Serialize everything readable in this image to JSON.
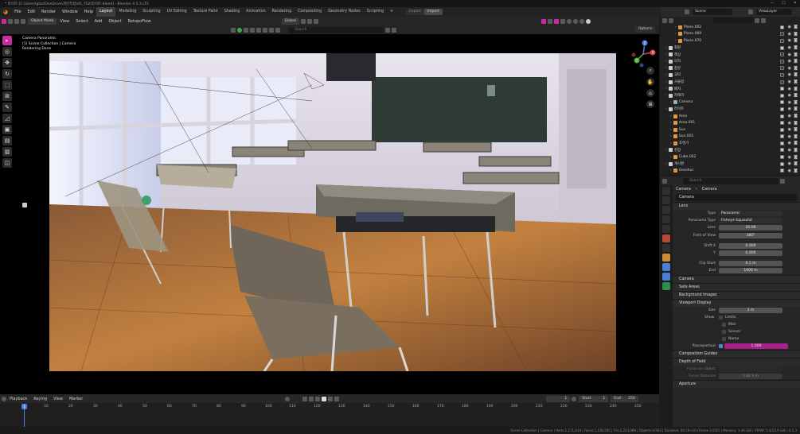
{
  "titlebar": {
    "text": "* 라이트 [C:\\Users\\glzx\\OneDrive\\개인작업\\05_학교\\라이트.blend] - Blender 4.5.3 LTS",
    "minimize": "—",
    "maximize": "☐",
    "close": "✕"
  },
  "menu": [
    "File",
    "Edit",
    "Render",
    "Window",
    "Help"
  ],
  "workspaces": [
    "Layout",
    "Modeling",
    "Sculpting",
    "UV Editing",
    "Texture Paint",
    "Shading",
    "Animation",
    "Rendering",
    "Compositing",
    "Geometry Nodes",
    "Scripting"
  ],
  "workspace_add": "+",
  "export_label": "Export",
  "import_label": "Import",
  "scene_label": "Scene",
  "viewlayer_label": "ViewLayer",
  "viewport_header": {
    "mode": "Object Mode",
    "menus": [
      "View",
      "Select",
      "Add",
      "Object"
    ],
    "retopo": "RetopoFlow",
    "transform": "Global"
  },
  "viewport_tools": {
    "search_placeholder": "Search"
  },
  "options_label": "Options",
  "render_info": [
    "Camera Panoramic",
    "(1) Scene Collection | Camera",
    "Rendering Done"
  ],
  "gizmo": {
    "x": "X",
    "y": "Y",
    "z": "Z"
  },
  "timeline": {
    "menus": [
      "Playback",
      "Keying",
      "View",
      "Marker"
    ],
    "current_frame": "1",
    "start_label": "Start",
    "start": "1",
    "end_label": "End",
    "end": "250",
    "ticks": [
      "10",
      "20",
      "30",
      "40",
      "50",
      "60",
      "70",
      "80",
      "90",
      "100",
      "110",
      "120",
      "130",
      "140",
      "150",
      "160",
      "170",
      "180",
      "190",
      "200",
      "210",
      "220",
      "230",
      "240",
      "250"
    ],
    "playhead": "1"
  },
  "statusbar": "Scene Collection | Camera | Verts:1,171,414 | Faces:1,138,595 | Tris:2,223,089 | Objects:0/363 | Duration: 00:10+10 (Frame 1/250) | Memory: 3.46 GiB | VRAM: 5.4/23.9 GiB | 4.5.3",
  "outliner": {
    "search_placeholder": "",
    "rows": [
      {
        "indent": 2,
        "label": "Plane.002",
        "color": "#e39a3b",
        "check": true
      },
      {
        "indent": 2,
        "label": "Plane.069",
        "color": "#e39a3b",
        "check": false
      },
      {
        "indent": 2,
        "label": "Plane.070",
        "color": "#e39a3b",
        "check": false
      },
      {
        "indent": 0,
        "label": "칠판",
        "color": "#cfcfcf",
        "check": true
      },
      {
        "indent": 0,
        "label": "책상",
        "color": "#cfcfcf",
        "check": false
      },
      {
        "indent": 0,
        "label": "의자",
        "color": "#cfcfcf",
        "check": false
      },
      {
        "indent": 0,
        "label": "창문",
        "color": "#cfcfcf",
        "check": false
      },
      {
        "indent": 0,
        "label": "교탁",
        "color": "#cfcfcf",
        "check": false
      },
      {
        "indent": 0,
        "label": "사물함",
        "color": "#cfcfcf",
        "check": false
      },
      {
        "indent": 0,
        "label": "배치",
        "color": "#cfcfcf",
        "check": true
      },
      {
        "indent": 0,
        "label": "카메라",
        "color": "#cfcfcf",
        "check": true
      },
      {
        "indent": 1,
        "label": "Camera",
        "color": "#7fb8d6",
        "check": true
      },
      {
        "indent": 0,
        "label": "라이트",
        "color": "#cfcfcf",
        "check": true
      },
      {
        "indent": 1,
        "label": "Area",
        "color": "#e39a3b",
        "check": true
      },
      {
        "indent": 1,
        "label": "Area.001",
        "color": "#e39a3b",
        "check": true
      },
      {
        "indent": 1,
        "label": "Sun",
        "color": "#e39a3b",
        "check": true
      },
      {
        "indent": 1,
        "label": "Sun.001",
        "color": "#e39a3b",
        "check": true
      },
      {
        "indent": 1,
        "label": "조명기",
        "color": "#e39a3b",
        "check": true
      },
      {
        "indent": 0,
        "label": "천장",
        "color": "#cfcfcf",
        "check": true
      },
      {
        "indent": 1,
        "label": "Cube.042",
        "color": "#e39a3b",
        "check": true
      },
      {
        "indent": 0,
        "label": "게시판",
        "color": "#cfcfcf",
        "check": true
      },
      {
        "indent": 1,
        "label": "Gesshul",
        "color": "#e39a3b",
        "check": true
      }
    ]
  },
  "properties": {
    "search_placeholder": "Search",
    "breadcrumb": [
      "Camera",
      "Camera"
    ],
    "datablock": "Camera",
    "lens_panel": "Lens",
    "props": [
      {
        "label": "Type",
        "value": "Panoramic",
        "dropdown": true
      },
      {
        "label": "Panorama Type",
        "value": "Fisheye Equisolid",
        "dropdown": true
      },
      {
        "label": "Lens",
        "value": "20.00"
      },
      {
        "label": "Field of View",
        "value": "360°"
      },
      {
        "label": "",
        "value": ""
      },
      {
        "label": "Shift X",
        "value": "0.000"
      },
      {
        "label": "Y",
        "value": "0.000"
      },
      {
        "label": "",
        "value": ""
      },
      {
        "label": "Clip Start",
        "value": "0.1 m"
      },
      {
        "label": "End",
        "value": "1000 m"
      }
    ],
    "collapsed_panels": [
      "Camera",
      "Safe Areas",
      "Background Images"
    ],
    "viewport_display": "Viewport Display",
    "vd_size_label": "Size",
    "vd_size": "1 m",
    "vd_show_label": "Show",
    "vd_checks": [
      "Limits",
      "Mist",
      "Sensor",
      "Name"
    ],
    "passepartout_label": "Passepartout",
    "passepartout_value": "1.000",
    "composition_guides": "Composition Guides",
    "dof_panel": "Depth of Field",
    "focus_object_label": "Focus on Object",
    "focus_distance_label": "Focus Distance",
    "focus_distance": "1.82 1 m",
    "aperture_panel": "Aperture"
  }
}
